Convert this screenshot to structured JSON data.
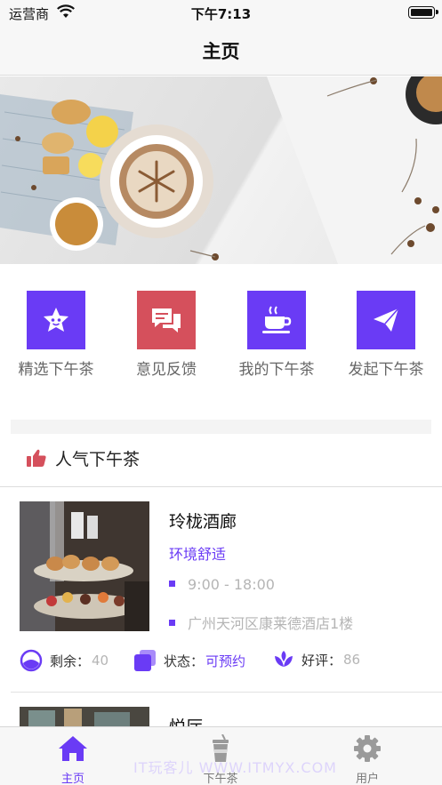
{
  "status_bar": {
    "carrier": "运营商",
    "time": "下午7:13"
  },
  "nav": {
    "title": "主页"
  },
  "banner": {
    "image": "afternoon-tea-cappuccino-cookies"
  },
  "menu": [
    {
      "label": "精选下午茶",
      "icon": "star-face-icon",
      "color": "#6a3bf5"
    },
    {
      "label": "意见反馈",
      "icon": "chat-bubbles-icon",
      "color": "#d5505c"
    },
    {
      "label": "我的下午茶",
      "icon": "coffee-cup-icon",
      "color": "#6a3bf5"
    },
    {
      "label": "发起下午茶",
      "icon": "paper-plane-icon",
      "color": "#6a3bf5"
    }
  ],
  "section": {
    "title": "人气下午茶",
    "icon": "thumbs-up-icon",
    "icon_color": "#d5505c"
  },
  "cards": [
    {
      "name": "玲栊酒廊",
      "tag": "环境舒适",
      "hours": "9:00 - 18:00",
      "address": "广州天河区康莱德酒店1楼",
      "remaining_label": "剩余：",
      "remaining_value": "40",
      "status_label": "状态：",
      "status_value": "可预约",
      "rating_label": "好评：",
      "rating_value": "86"
    },
    {
      "name": "悦厅"
    }
  ],
  "tabbar": {
    "tabs": [
      {
        "label": "主页",
        "icon": "home-icon",
        "active": true
      },
      {
        "label": "下午茶",
        "icon": "drink-cup-icon",
        "active": false
      },
      {
        "label": "用户",
        "icon": "gear-icon",
        "active": false
      }
    ],
    "watermark": "IT玩客儿 WWW.ITMYX.COM"
  },
  "colors": {
    "accent": "#6a3bf5",
    "feedback_red": "#d5505c"
  }
}
